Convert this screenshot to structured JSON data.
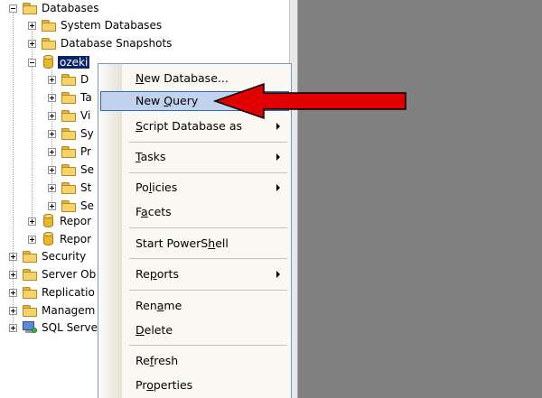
{
  "tree": {
    "nodes": [
      {
        "label": "Databases"
      },
      {
        "label": "System Databases"
      },
      {
        "label": "Database Snapshots"
      },
      {
        "label": "ozeki"
      },
      {
        "label": "D"
      },
      {
        "label": "Ta"
      },
      {
        "label": "Vi"
      },
      {
        "label": "Sy"
      },
      {
        "label": "Pr"
      },
      {
        "label": "Se"
      },
      {
        "label": "St"
      },
      {
        "label": "Se"
      },
      {
        "label": "Repor"
      },
      {
        "label": "Repor"
      },
      {
        "label": "Security"
      },
      {
        "label": "Server Ob"
      },
      {
        "label": "Replicatio"
      },
      {
        "label": "Managem"
      },
      {
        "label": "SQL Serve"
      }
    ]
  },
  "context_menu": {
    "items": [
      {
        "pre": "",
        "key": "N",
        "post": "ew Database..."
      },
      {
        "pre": "New ",
        "key": "Q",
        "post": "uery"
      },
      {
        "pre": "",
        "key": "S",
        "post": "cript Database as"
      },
      {
        "pre": "",
        "key": "T",
        "post": "asks"
      },
      {
        "pre": "Po",
        "key": "l",
        "post": "icies"
      },
      {
        "pre": "F",
        "key": "a",
        "post": "cets"
      },
      {
        "pre": "Start PowerS",
        "key": "h",
        "post": "ell"
      },
      {
        "pre": "Re",
        "key": "p",
        "post": "orts"
      },
      {
        "pre": "Ren",
        "key": "a",
        "post": "me"
      },
      {
        "pre": "",
        "key": "D",
        "post": "elete"
      },
      {
        "pre": "Re",
        "key": "f",
        "post": "resh"
      },
      {
        "pre": "Pr",
        "key": "o",
        "post": "perties"
      }
    ],
    "highlighted_item": "New Query"
  },
  "annotation": {
    "arrow_color": "#e10000",
    "points_to": "New Query"
  },
  "colors": {
    "selection": "#0a246a",
    "menu_highlight": "#c1d2ee",
    "menu_highlight_border": "#316ac5",
    "background_pane": "#808080",
    "folder": "#f6d36a"
  }
}
